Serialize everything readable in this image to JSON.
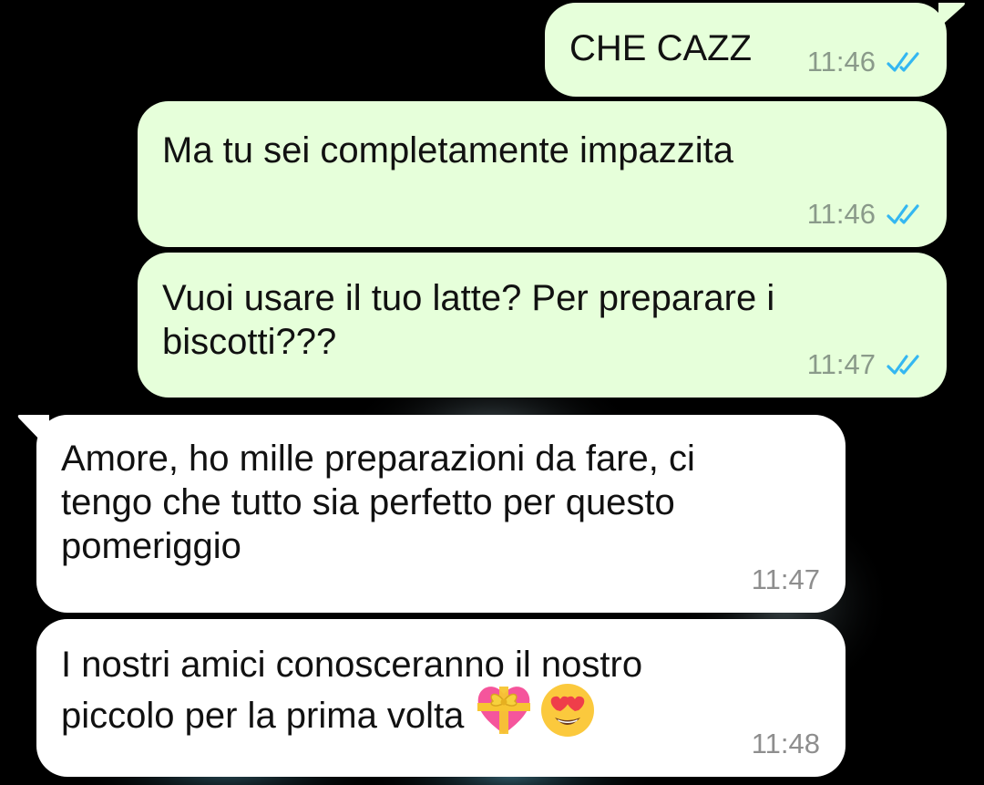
{
  "chat": {
    "messages": [
      {
        "direction": "outgoing",
        "lines": [
          "CHE CAZZ"
        ],
        "time": "11:46",
        "status": "read"
      },
      {
        "direction": "outgoing",
        "lines": [
          "Ma tu sei completamente impazzita"
        ],
        "time": "11:46",
        "status": "read"
      },
      {
        "direction": "outgoing",
        "lines": [
          "Vuoi usare il tuo latte? Per preparare i",
          "biscotti???"
        ],
        "time": "11:47",
        "status": "read"
      },
      {
        "direction": "incoming",
        "lines": [
          "Amore, ho mille preparazioni da fare, ci",
          "tengo che tutto sia perfetto per questo",
          "pomeriggio"
        ],
        "time": "11:47"
      },
      {
        "direction": "incoming",
        "lines": [
          "I nostri amici conosceranno il nostro",
          "piccolo per la prima volta"
        ],
        "emojis": [
          "heart-with-ribbon-emoji",
          "heart-eyes-emoji"
        ],
        "time": "11:48"
      }
    ]
  },
  "colors": {
    "background": "#000000",
    "outgoing_bubble": "#e6ffda",
    "incoming_bubble": "#ffffff",
    "read_tick": "#34b7f1",
    "timestamp": "#8a9a8a"
  },
  "icons": {
    "read_receipt": "double-check-icon"
  }
}
